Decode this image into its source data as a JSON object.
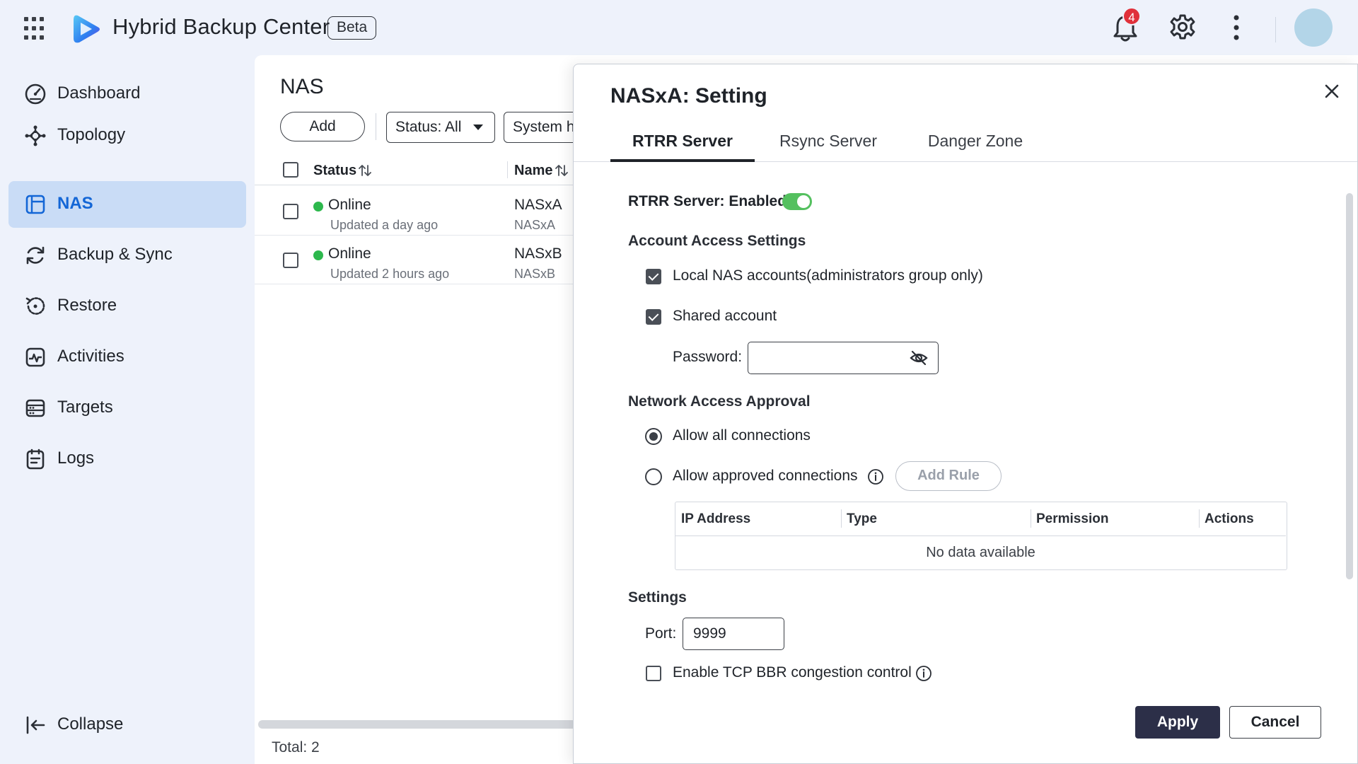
{
  "app": {
    "title": "Hybrid Backup Center",
    "badge": "Beta",
    "notification_count": "4"
  },
  "sidebar": {
    "items": [
      {
        "label": "Dashboard",
        "icon": "gauge-icon"
      },
      {
        "label": "Topology",
        "icon": "topology-icon"
      },
      {
        "label": "NAS",
        "icon": "nas-icon",
        "active": true
      },
      {
        "label": "Backup & Sync",
        "icon": "sync-icon"
      },
      {
        "label": "Restore",
        "icon": "restore-icon"
      },
      {
        "label": "Activities",
        "icon": "activity-icon"
      },
      {
        "label": "Targets",
        "icon": "targets-icon"
      },
      {
        "label": "Logs",
        "icon": "logs-icon"
      }
    ],
    "collapse_label": "Collapse"
  },
  "main": {
    "title": "NAS",
    "add_label": "Add",
    "status_filter": "Status: All",
    "system_filter": "System h",
    "columns": [
      "Status",
      "Name"
    ],
    "rows": [
      {
        "status": "Online",
        "updated": "Updated a day ago",
        "name": "NASxA",
        "sub": "NASxA"
      },
      {
        "status": "Online",
        "updated": "Updated 2 hours ago",
        "name": "NASxB",
        "sub": "NASxB"
      }
    ],
    "total": "Total: 2"
  },
  "dialog": {
    "title": "NASxA: Setting",
    "tabs": [
      "RTRR Server",
      "Rsync Server",
      "Danger Zone"
    ],
    "server_status": "RTRR Server: Enabled",
    "account_section": "Account Access Settings",
    "local_accounts_label": "Local NAS accounts(administrators group only)",
    "shared_account_label": "Shared account",
    "password_label": "Password:",
    "password_value": "",
    "network_section": "Network Access Approval",
    "allow_all_label": "Allow all connections",
    "allow_approved_label": "Allow approved connections",
    "add_rule_label": "Add Rule",
    "rules_columns": [
      "IP Address",
      "Type",
      "Permission",
      "Actions"
    ],
    "rules_empty": "No data available",
    "settings_section": "Settings",
    "port_label": "Port:",
    "port_value": "9999",
    "tcp_bbr_label": "Enable TCP BBR congestion control",
    "apply_label": "Apply",
    "cancel_label": "Cancel"
  },
  "colors": {
    "accent": "#1366d6",
    "online": "#2db84d",
    "toggle_on": "#54c05f",
    "primary_button": "#2c2f48",
    "badge_red": "#e0303a"
  }
}
